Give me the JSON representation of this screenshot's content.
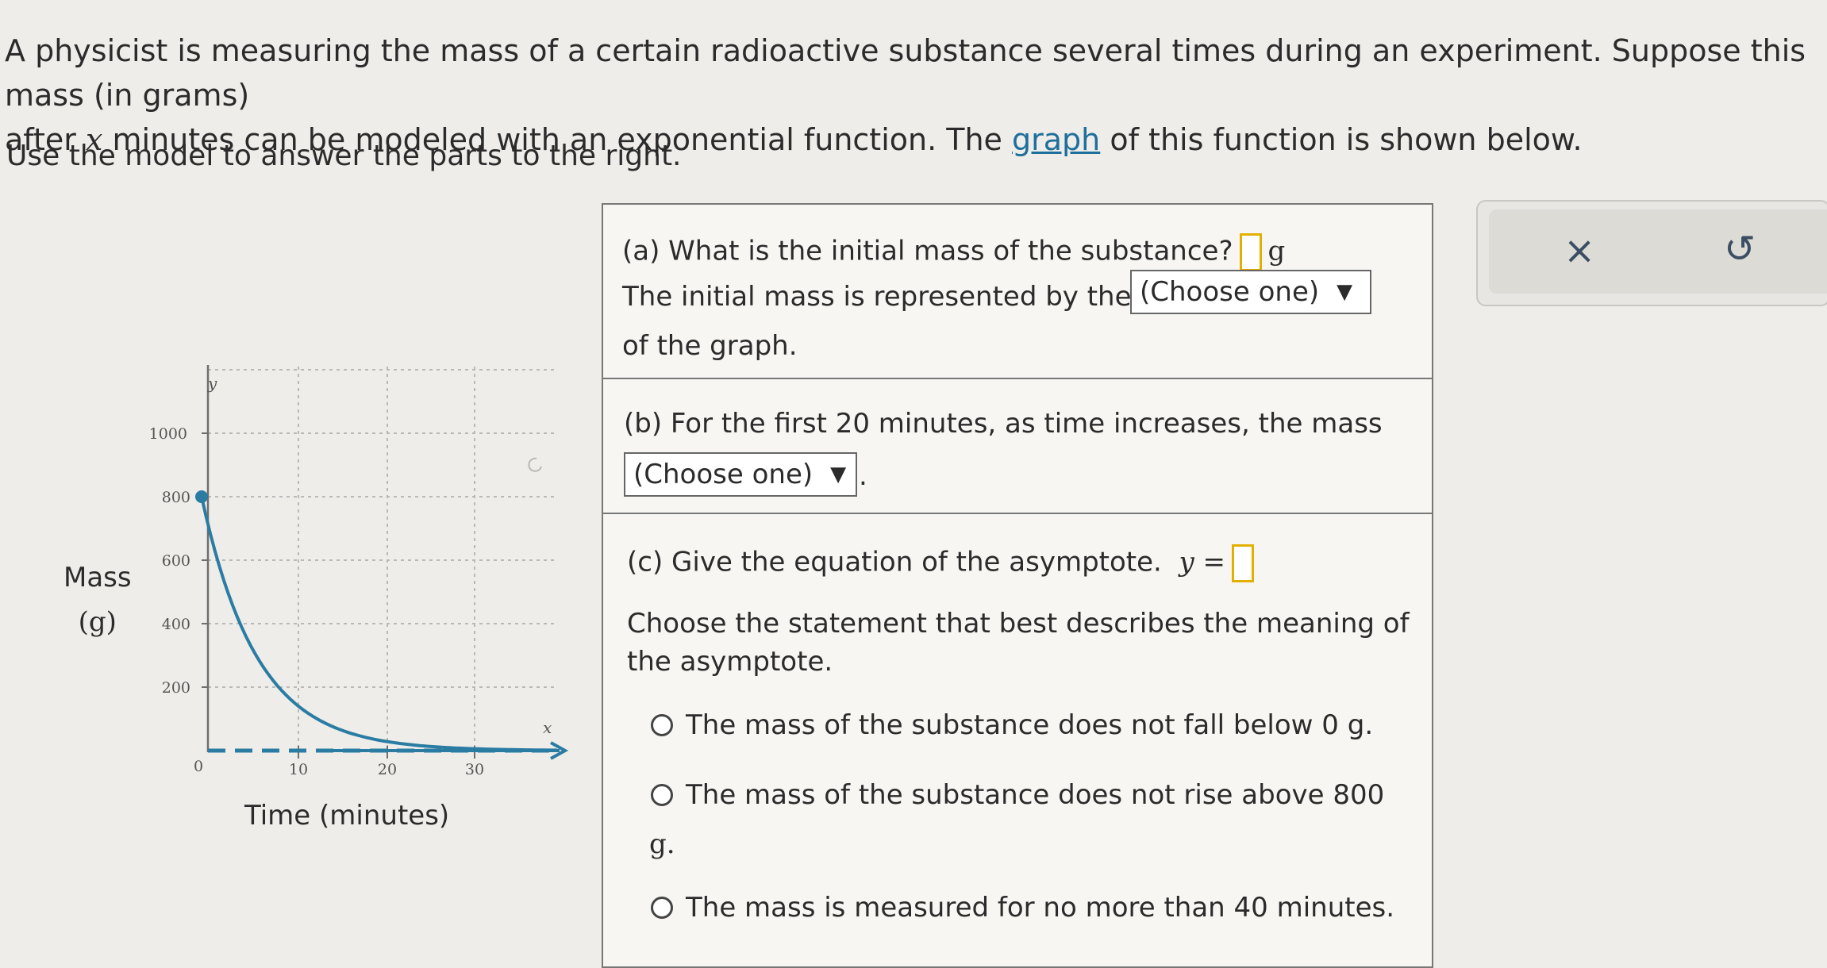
{
  "intro": {
    "line1": "A physicist is measuring the mass of a certain radioactive substance several times during an experiment. Suppose this mass (in grams)",
    "line2_before_var": "after ",
    "var": "x",
    "line2_mid": " minutes can be modeled with an exponential function. The ",
    "link": "graph",
    "line2_after": " of this function is shown below."
  },
  "instructions": "Use the model to answer the parts to the right.",
  "graph": {
    "y_axis_label": "Mass",
    "y_axis_unit": "(g)",
    "x_axis_label": "Time (minutes)",
    "y_var": "y",
    "x_var": "x",
    "y_ticks": [
      "1000",
      "800",
      "600",
      "400",
      "200"
    ],
    "origin": "0",
    "x_ticks": [
      "10",
      "20",
      "30"
    ],
    "initial_value": 800,
    "asymptote_value": 0,
    "curve_color": "#2b7ca3",
    "asymptote_color": "#2b7ca3"
  },
  "part_a": {
    "question": "(a) What is the initial mass of the substance?",
    "unit": "g",
    "line2": "The initial mass is represented by the",
    "dropdown": "(Choose one)",
    "line3": "of the graph."
  },
  "part_b": {
    "question": "(b) For the first 20 minutes, as time increases, the mass",
    "dropdown": "(Choose one)",
    "trail": "."
  },
  "part_c": {
    "question": "(c) Give the equation of the asymptote.",
    "eq_prefix": "y =",
    "statement_line1": "Choose the statement that best describes the meaning of",
    "statement_line2": "the asymptote.",
    "options": [
      "The mass of the substance does not fall below 0 g.",
      "The mass of the substance does not rise above 800",
      "The mass is measured for no more than 40 minutes."
    ],
    "option2_wrap": "g."
  },
  "actions": {
    "clear_icon": "×",
    "undo_icon": "↺"
  }
}
